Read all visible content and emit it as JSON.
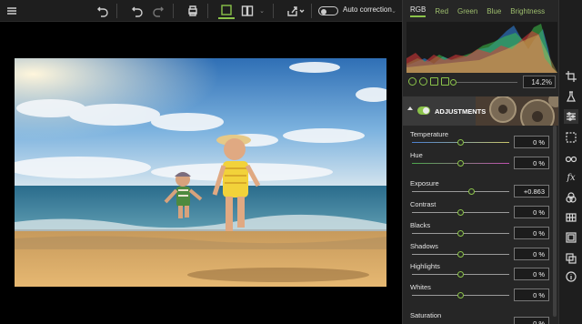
{
  "toolbar": {
    "auto_correction_label": "Auto correction",
    "icons": [
      "menu-icon",
      "undo-all-icon",
      "undo-icon",
      "redo-icon",
      "print-icon",
      "single-view-icon",
      "split-view-icon",
      "share-icon"
    ]
  },
  "panel": {
    "tabs": [
      "RGB",
      "Red",
      "Green",
      "Blue",
      "Brightness"
    ],
    "active_tab": "RGB",
    "zoom_value": "14.2%",
    "adjustments_title": "ADJUSTMENTS",
    "sliders": [
      {
        "label": "Temperature",
        "value": "0 %"
      },
      {
        "label": "Hue",
        "value": "0 %"
      },
      {
        "label": "Exposure",
        "value": "+0.863"
      },
      {
        "label": "Contrast",
        "value": "0 %"
      },
      {
        "label": "Blacks",
        "value": "0 %"
      },
      {
        "label": "Shadows",
        "value": "0 %"
      },
      {
        "label": "Highlights",
        "value": "0 %"
      },
      {
        "label": "Whites",
        "value": "0 %"
      },
      {
        "label": "Saturation",
        "value": "0 %"
      }
    ]
  },
  "rail": {
    "icons": [
      "crop-icon",
      "flask-icon",
      "adjust-sliders-icon",
      "selection-icon",
      "glasses-icon",
      "fx-icon",
      "color-wheel-icon",
      "grid-icon",
      "frame-icon",
      "layers-icon",
      "info-icon"
    ]
  },
  "colors": {
    "accent": "#8bc34a"
  }
}
